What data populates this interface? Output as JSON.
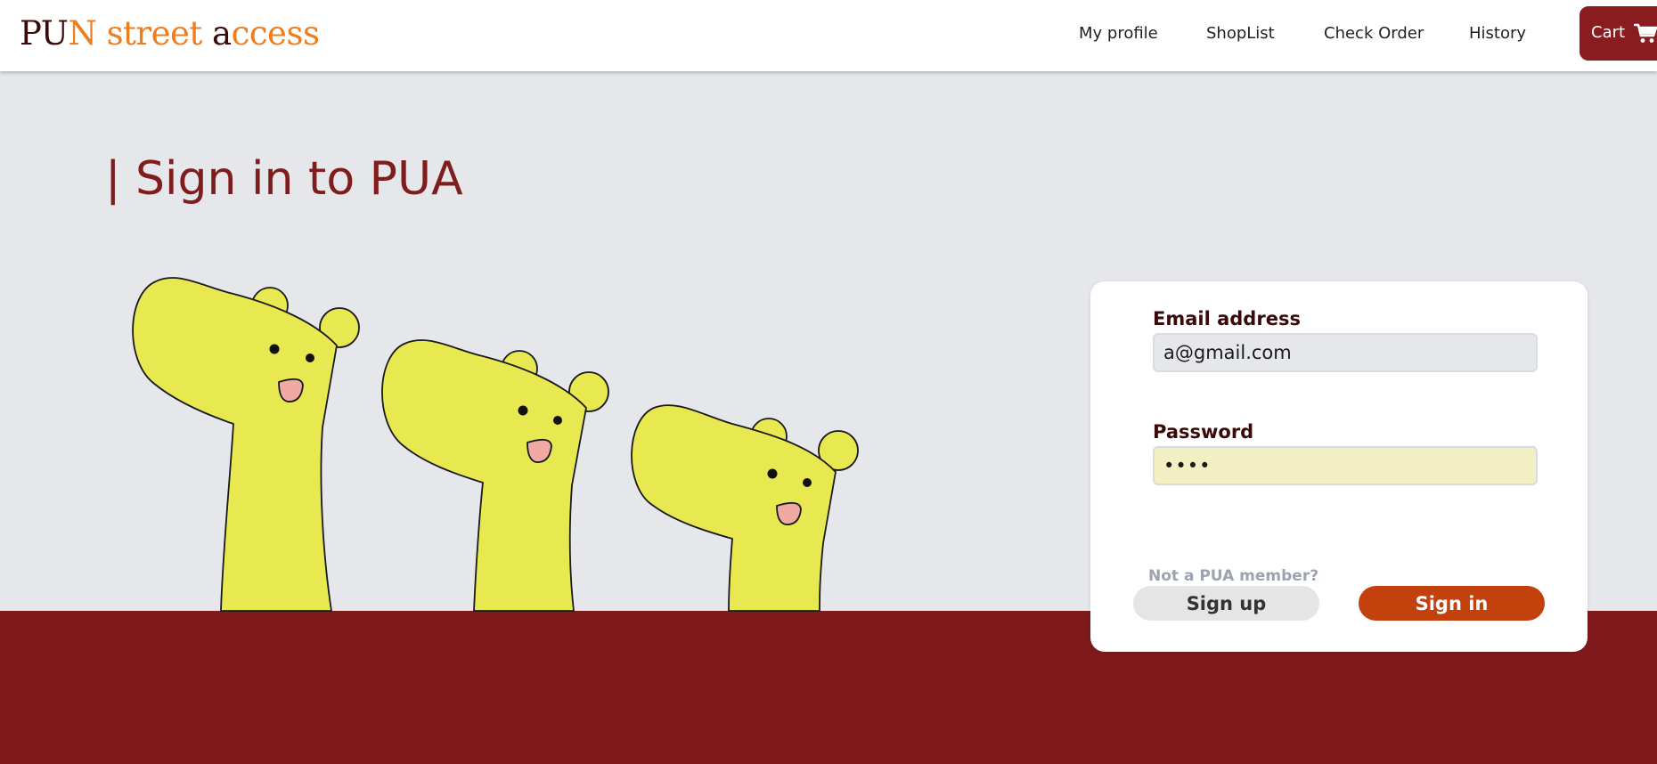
{
  "header": {
    "logo": {
      "part1": "PU",
      "part2": "N street ",
      "part3": "a",
      "part4": "ccess"
    },
    "nav": [
      "My profile",
      "ShopList",
      "Check Order",
      "History"
    ],
    "cart_label": "Cart"
  },
  "main": {
    "title": "| Sign in to PUA"
  },
  "login": {
    "email_label": "Email address",
    "email_value": "a@gmail.com",
    "password_label": "Password",
    "password_value": "••••",
    "member_hint": "Not a PUA member?",
    "signup_label": "Sign up",
    "signin_label": "Sign in"
  },
  "colors": {
    "brand_dark": "#3a0a0a",
    "brand_orange": "#f07c1c",
    "accent_red": "#8a1c1f",
    "footer_red": "#7f1a1c",
    "signin_orange": "#c2410c",
    "mascot_yellow": "#e8e851"
  },
  "icons": [
    "cart-icon"
  ]
}
